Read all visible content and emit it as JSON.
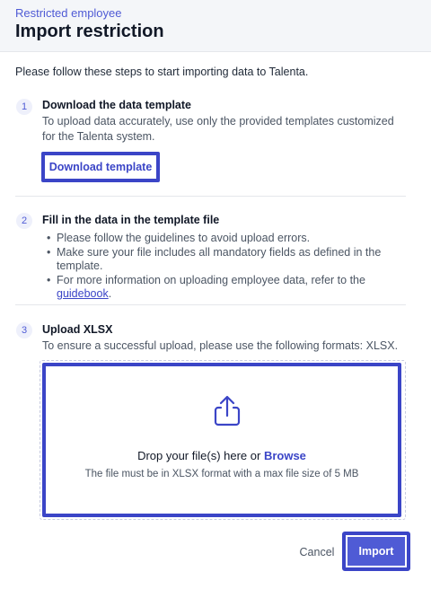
{
  "header": {
    "breadcrumb": "Restricted employee",
    "title": "Import restriction"
  },
  "intro": "Please follow these steps to start importing data to Talenta.",
  "steps": [
    {
      "number": "1",
      "title": "Download the data template",
      "description": "To upload data accurately, use only the provided templates customized for the Talenta system.",
      "button_label": "Download template"
    },
    {
      "number": "2",
      "title": "Fill in the data in the template file",
      "bullets": [
        "Please follow the guidelines to avoid upload errors.",
        "Make sure your file includes all mandatory fields as defined in the template.",
        "For more information on uploading employee data, refer to the "
      ],
      "link_text": "guidebook",
      "link_suffix": "."
    },
    {
      "number": "3",
      "title": "Upload XLSX",
      "description": "To ensure a successful upload, please use the following formats: XLSX.",
      "dropzone": {
        "icon": "upload-icon",
        "text_prefix": "Drop your file(s) here or ",
        "browse_label": "Browse",
        "hint": "The file must be in XLSX format with a max file size of 5 MB"
      }
    }
  ],
  "footer": {
    "cancel_label": "Cancel",
    "import_label": "Import"
  },
  "colors": {
    "accent": "#4f5bd5",
    "highlight_border": "#3b45c7",
    "header_bg": "#f4f6f9"
  }
}
